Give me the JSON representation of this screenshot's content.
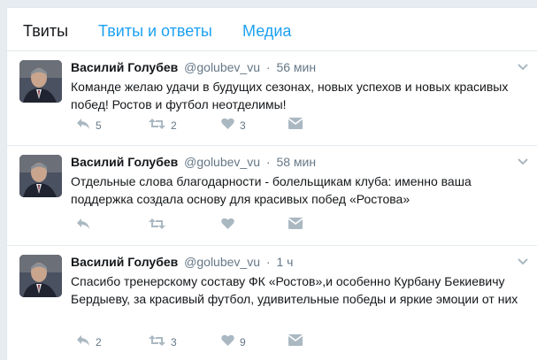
{
  "tabs": [
    {
      "label": "Твиты"
    },
    {
      "label": "Твиты и ответы"
    },
    {
      "label": "Медиа"
    }
  ],
  "tweets": [
    {
      "name": "Василий Голубев",
      "handle": "@golubev_vu",
      "dot": "·",
      "time": "56 мин",
      "text": "Команде желаю удачи в будущих сезонах, новых успехов и новых красивых побед! Ростов и футбол неотделимы!",
      "replies": "5",
      "retweets": "2",
      "likes": "3"
    },
    {
      "name": "Василий Голубев",
      "handle": "@golubev_vu",
      "dot": "·",
      "time": "58 мин",
      "text": "Отдельные слова благодарности - болельщикам клуба: именно ваша поддержка создала основу для красивых побед «Ростова»",
      "replies": "",
      "retweets": "",
      "likes": ""
    },
    {
      "name": "Василий Голубев",
      "handle": "@golubev_vu",
      "dot": "·",
      "time": "1 ч",
      "text": "Спасибо тренерскому составу ФК «Ростов»,и особенно Курбану Бекиевичу Бердыеву, за красивый футбол, удивительные победы и яркие эмоции от них",
      "replies": "2",
      "retweets": "3",
      "likes": "9"
    }
  ],
  "colors": {
    "accent": "#1da1f2",
    "muted": "#657786",
    "icon": "#aab8c2",
    "background": "#e6ecf0"
  },
  "icons": {
    "reply": "reply-icon",
    "retweet": "retweet-icon",
    "like": "heart-icon",
    "dm": "envelope-icon",
    "menu": "chevron-down-icon"
  }
}
